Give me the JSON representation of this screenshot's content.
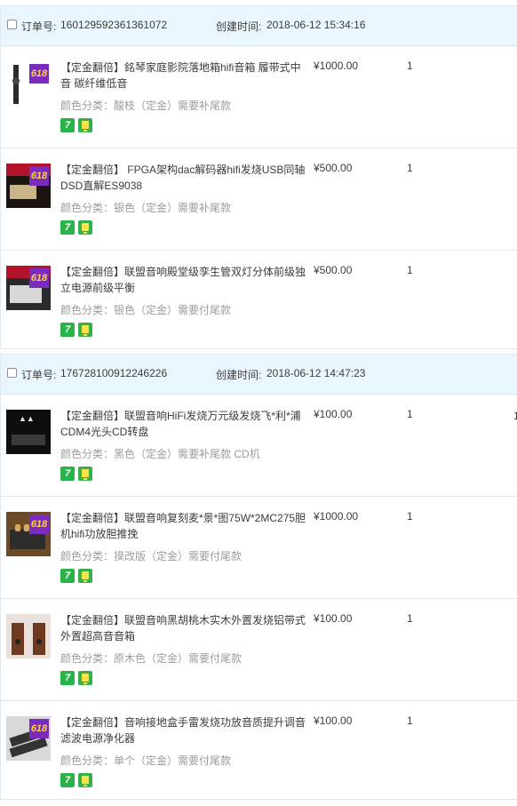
{
  "labels": {
    "order_no": "订单号:",
    "created": "创建时间:",
    "badge618": "618"
  },
  "orders": [
    {
      "number": "160129592361361072",
      "created_at": "2018-06-12 15:34:16",
      "items": [
        {
          "title": "【定金翻倍】銘琴家庭影院落地箱hifi音箱 履带式中音 碳纤维低音",
          "attr": "颜色分类：酸枝（定金）需要补尾款",
          "price": "¥1000.00",
          "qty": "1"
        },
        {
          "title": "【定金翻倍】 FPGA架构dac解码器hifi发烧USB同轴DSD直解ES9038",
          "attr": "颜色分类：银色（定金）需要补尾款",
          "price": "¥500.00",
          "qty": "1"
        },
        {
          "title": "【定金翻倍】联盟音响殿堂级孪生管双灯分体前级独立电源前级平衡",
          "attr": "颜色分类：银色（定金）需要付尾款",
          "price": "¥500.00",
          "qty": "1"
        }
      ]
    },
    {
      "number": "176728100912246226",
      "created_at": "2018-06-12 14:47:23",
      "items": [
        {
          "title": "【定金翻倍】联盟音响HiFi发烧万元级发烧飞*利*浦CDM4光头CD转盘",
          "attr": "颜色分类：黑色（定金）需要补尾款 CD机",
          "price": "¥100.00",
          "qty": "1"
        },
        {
          "title": "【定金翻倍】联盟音响复刻麦*景*图75W*2MC275胆机hifi功放胆推挽",
          "attr": "颜色分类：摸改版（定金）需要付尾款",
          "price": "¥1000.00",
          "qty": "1"
        },
        {
          "title": "【定金翻倍】联盟音响黑胡桃木实木外置发烧铝带式外置超高音音箱",
          "attr": "颜色分类：原木色（定金）需要付尾款",
          "price": "¥100.00",
          "qty": "1"
        },
        {
          "title": "【定金翻倍】音响接地盒手雷发烧功放音质提升调音滤波电源净化器",
          "attr": "颜色分类：单个（定金）需要付尾款",
          "price": "¥100.00",
          "qty": "1"
        }
      ]
    }
  ],
  "edge_text": "1"
}
